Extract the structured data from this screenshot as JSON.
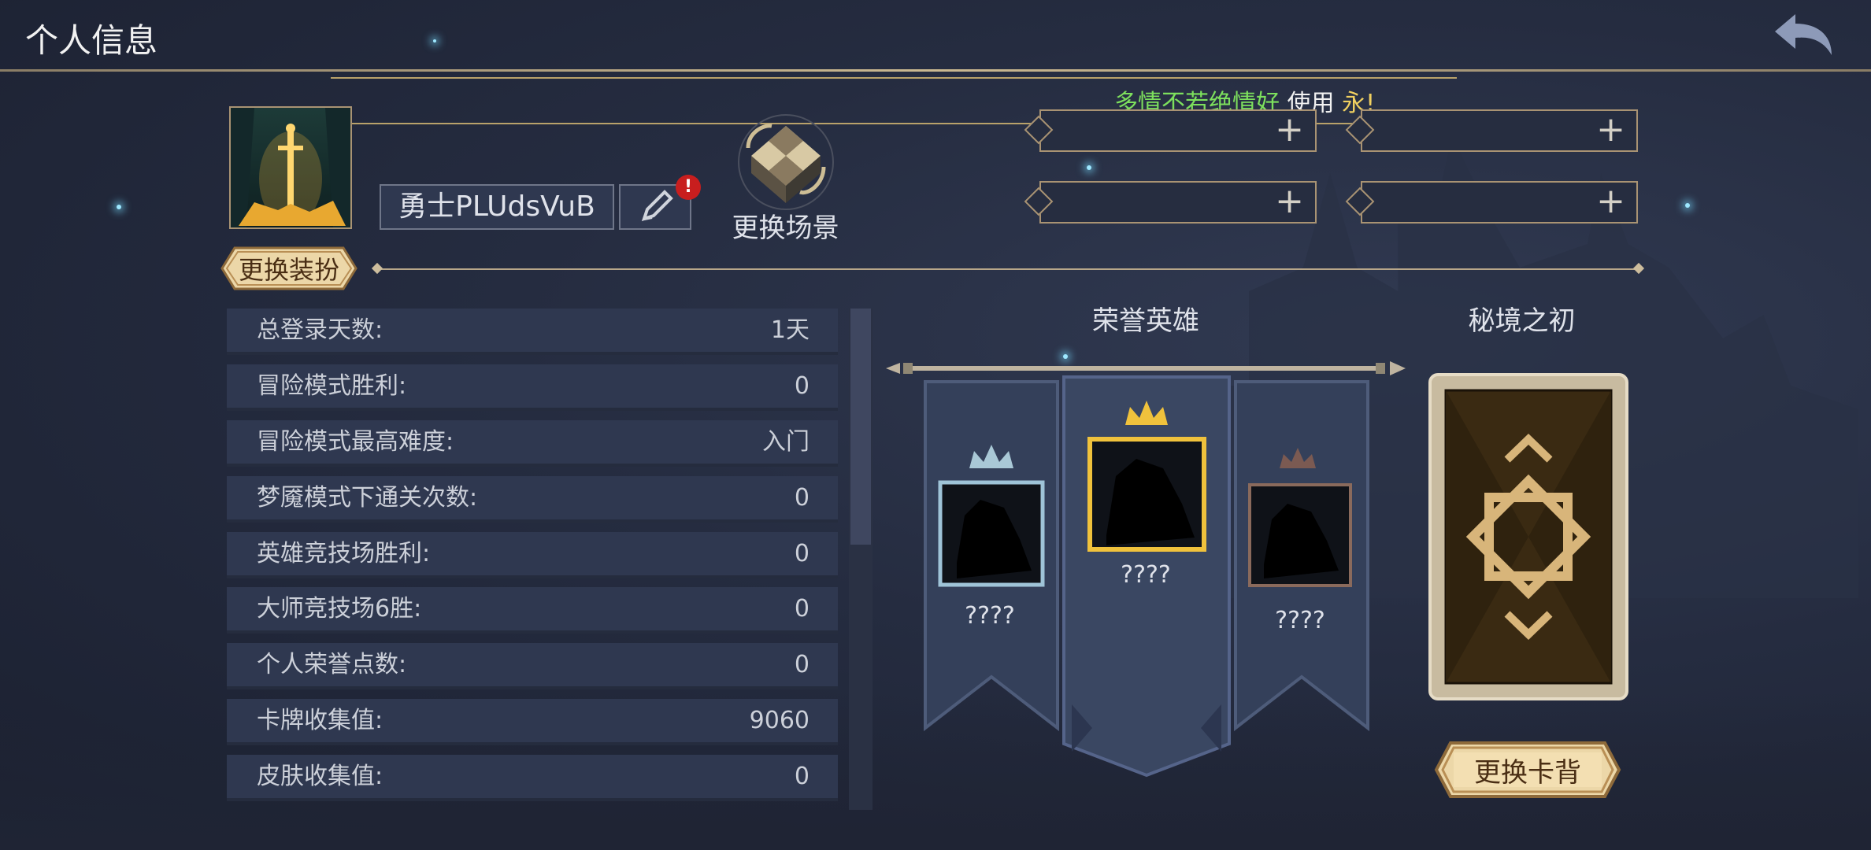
{
  "header": {
    "title": "个人信息"
  },
  "marquee": {
    "part1": "多情不若绝情好",
    "part2": "使用",
    "part3": "永!"
  },
  "profile": {
    "name": "勇士PLUdsVuB",
    "notification_badge": "!"
  },
  "scene": {
    "label": "更换场景"
  },
  "outfit": {
    "button_label": "更换装扮"
  },
  "stats": [
    {
      "label": "总登录天数:",
      "value": "1天"
    },
    {
      "label": "冒险模式胜利:",
      "value": "0"
    },
    {
      "label": "冒险模式最高难度:",
      "value": "入门"
    },
    {
      "label": "梦魇模式下通关次数:",
      "value": "0"
    },
    {
      "label": "英雄竞技场胜利:",
      "value": "0"
    },
    {
      "label": "大师竞技场6胜:",
      "value": "0"
    },
    {
      "label": "个人荣誉点数:",
      "value": "0"
    },
    {
      "label": "卡牌收集值:",
      "value": "9060"
    },
    {
      "label": "皮肤收集值:",
      "value": "0"
    }
  ],
  "honor": {
    "title": "荣誉英雄",
    "heroes": [
      {
        "rank": "silver",
        "name": "????"
      },
      {
        "rank": "gold",
        "name": "????"
      },
      {
        "rank": "bronze",
        "name": "????"
      }
    ]
  },
  "card_back": {
    "title": "秘境之初",
    "button_label": "更换卡背"
  },
  "colors": {
    "gold": "#f0c23c",
    "silver": "#9fc4d8",
    "bronze": "#8a6a5c",
    "accent": "#b9a26a"
  }
}
